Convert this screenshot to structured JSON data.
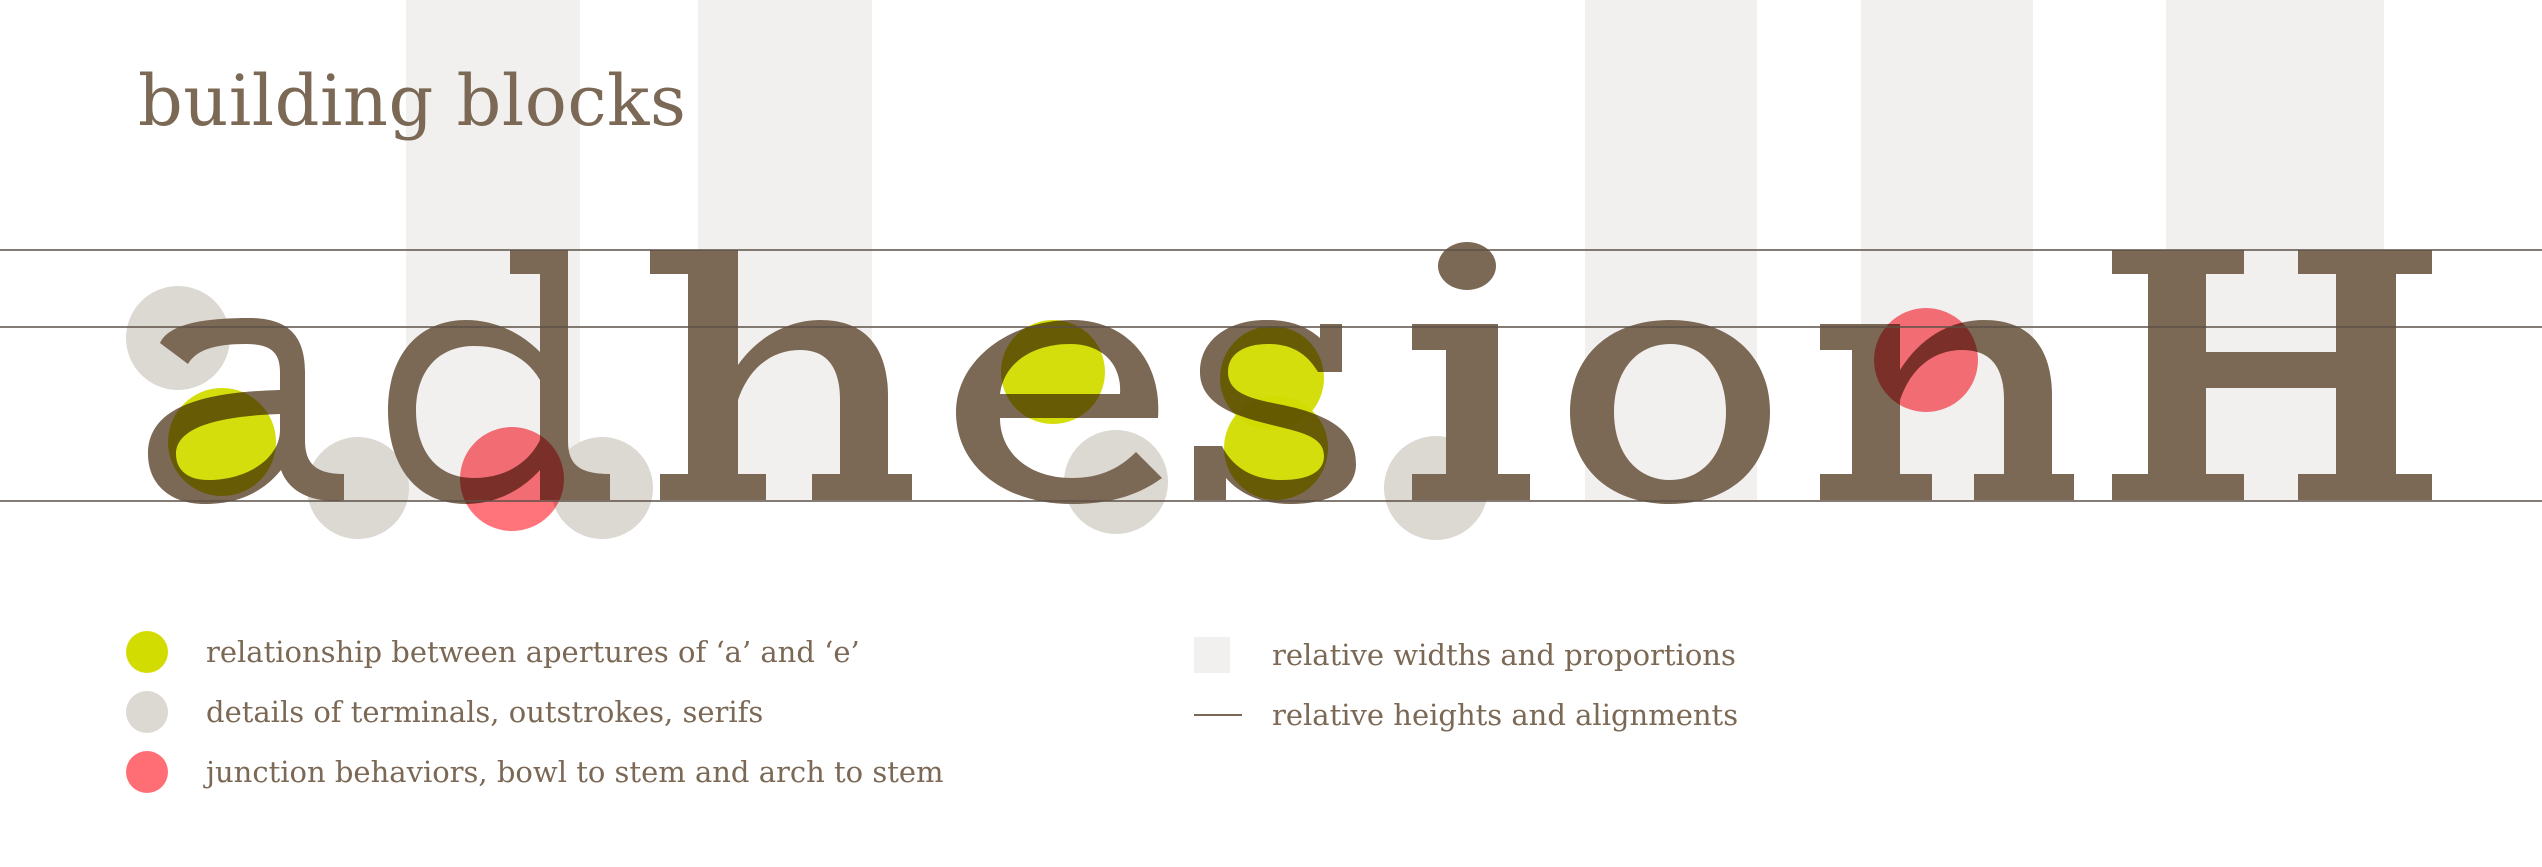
{
  "title": "building blocks",
  "specimen_word": "adhesionH",
  "colors": {
    "glyph": "#7b6855",
    "aperture": "#d3dc00",
    "terminal": "#dcd8d2",
    "junction": "#ff5a64",
    "width_band": "#f1f0ef",
    "guide_line": "#5c5046"
  },
  "legend": {
    "left": [
      {
        "label": "relationship between apertures of ‘a’ and ‘e’",
        "swatch": "circle",
        "color": "#d3dc00",
        "icon": "yellow-circle-icon"
      },
      {
        "label": "details of terminals, outstrokes, serifs",
        "swatch": "circle",
        "color": "#dcd8d2",
        "icon": "grey-circle-icon"
      },
      {
        "label": "junction behaviors, bowl to stem and arch to stem",
        "swatch": "circle",
        "color": "#ff6e74",
        "icon": "red-circle-icon"
      }
    ],
    "right": [
      {
        "label": "relative widths and proportions",
        "swatch": "square",
        "color": "#f1f0ef",
        "icon": "grey-square-icon"
      },
      {
        "label": "relative heights and alignments",
        "swatch": "line",
        "color": "#7b6855",
        "icon": "line-icon"
      }
    ]
  }
}
